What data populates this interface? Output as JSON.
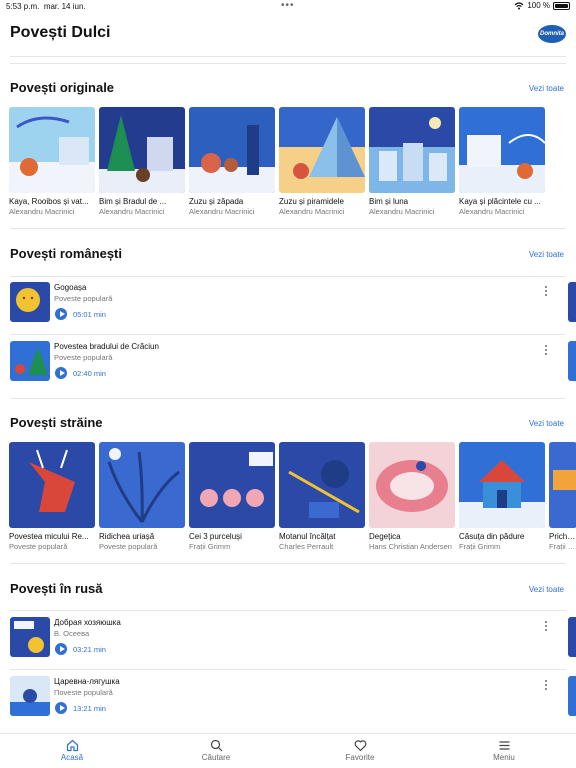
{
  "status": {
    "time": "5:53 p.m.",
    "date": "mar. 14 iun.",
    "battery": "100 %"
  },
  "app": {
    "title": "Povești Dulci",
    "brand": "Domnita"
  },
  "sections": {
    "originals": {
      "title": "Povești originale",
      "see_all": "Vezi toate",
      "items": [
        {
          "name": "Kaya, Rooibos și vat...",
          "author": "Alexandru Macrinici"
        },
        {
          "name": "Bim și Bradul de ...",
          "author": "Alexandru Macrinici"
        },
        {
          "name": "Zuzu și zăpada",
          "author": "Alexandru Macrinici"
        },
        {
          "name": "Zuzu și piramidele",
          "author": "Alexandru Macrinici"
        },
        {
          "name": "Bim și luna",
          "author": "Alexandru Macrinici"
        },
        {
          "name": "Kaya și plăcintele cu ...",
          "author": "Alexandru Macrinici"
        }
      ]
    },
    "romanian": {
      "title": "Povești românești",
      "see_all": "Vezi toate",
      "items": [
        {
          "title": "Gogoașa",
          "sub": "Poveste populară",
          "duration": "05:01 min"
        },
        {
          "title": "Povestea bradului de Crăciun",
          "sub": "Poveste populară",
          "duration": "02:40 min"
        }
      ]
    },
    "foreign": {
      "title": "Povești străine",
      "see_all": "Vezi toate",
      "items": [
        {
          "name": "Povestea micului Re...",
          "author": "Poveste populară"
        },
        {
          "name": "Ridichea uriașă",
          "author": "Poveste populară"
        },
        {
          "name": "Cei 3 purceluși",
          "author": "Frații Grimm"
        },
        {
          "name": "Motanul încălțat",
          "author": "Charles Perrault"
        },
        {
          "name": "Degețica",
          "author": "Hans Christian Andersen"
        },
        {
          "name": "Căsuța din pădure",
          "author": "Frații Grimm"
        },
        {
          "name": "Prichin...",
          "author": "Frații Gr..."
        }
      ]
    },
    "russian": {
      "title": "Povești în rusă",
      "see_all": "Vezi toate",
      "items": [
        {
          "title": "Добрая хозяюшка",
          "sub": "В. Осеева",
          "duration": "03:21 min"
        },
        {
          "title": "Царевна-лягушка",
          "sub": "Поveste populară",
          "duration": "13:21 min"
        }
      ]
    }
  },
  "tabs": [
    {
      "label": "Acasă",
      "icon": "home-icon",
      "active": true
    },
    {
      "label": "Căutare",
      "icon": "search-icon",
      "active": false
    },
    {
      "label": "Favorite",
      "icon": "heart-icon",
      "active": false
    },
    {
      "label": "Meniu",
      "icon": "menu-icon",
      "active": false
    }
  ],
  "colors": {
    "accent": "#2f6fd6",
    "card_blue": "#2b4aa8",
    "card_red": "#d9473b"
  }
}
